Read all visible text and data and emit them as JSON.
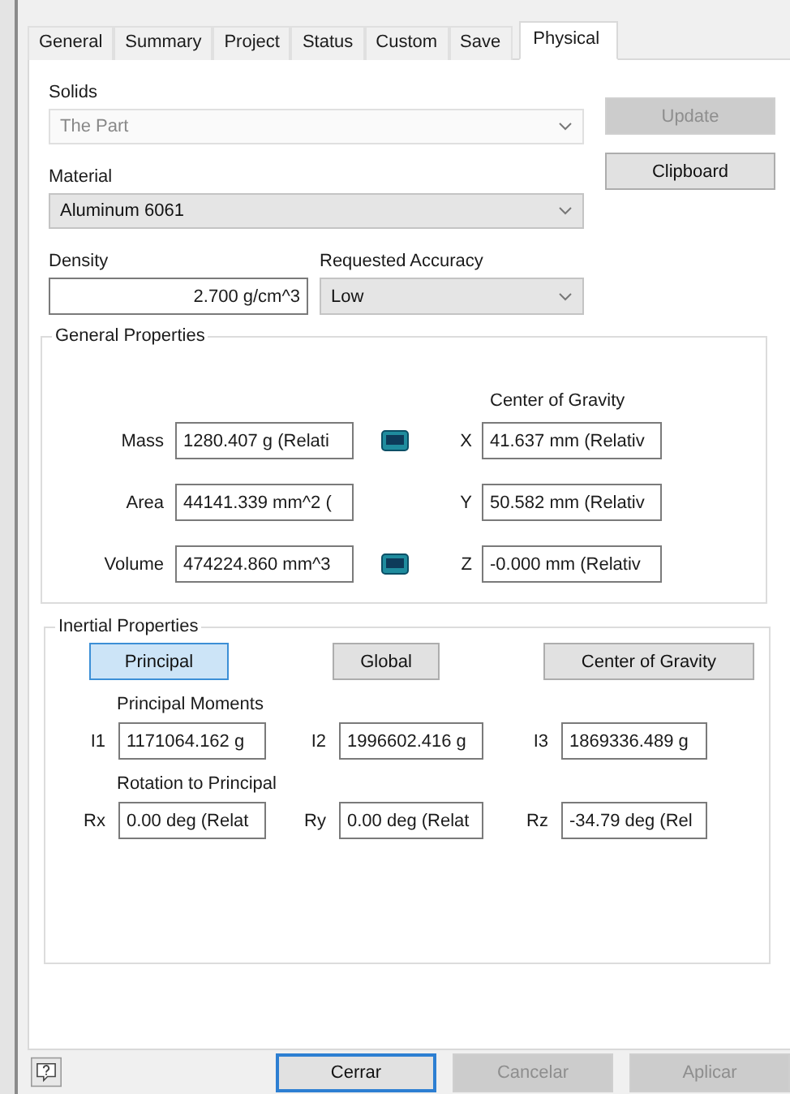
{
  "tabs": [
    {
      "label": "General",
      "selected": false
    },
    {
      "label": "Summary",
      "selected": false
    },
    {
      "label": "Project",
      "selected": false
    },
    {
      "label": "Status",
      "selected": false
    },
    {
      "label": "Custom",
      "selected": false
    },
    {
      "label": "Save",
      "selected": false
    },
    {
      "label": "Physical",
      "selected": true
    }
  ],
  "solids": {
    "label": "Solids",
    "value": "The Part",
    "disabled": true
  },
  "update_button": {
    "label": "Update",
    "disabled": true
  },
  "material": {
    "label": "Material",
    "value": "Aluminum 6061"
  },
  "clipboard_button": {
    "label": "Clipboard",
    "disabled": false
  },
  "density": {
    "label": "Density",
    "value": "2.700 g/cm^3"
  },
  "requested_accuracy": {
    "label": "Requested Accuracy",
    "value": "Low"
  },
  "general_properties": {
    "title": "General Properties",
    "center_of_gravity_label": "Center of Gravity",
    "rows": [
      {
        "label": "Mass",
        "value": "1280.407 g (Relati",
        "calculator": true,
        "axis": "X",
        "axis_value": "41.637 mm (Relativ"
      },
      {
        "label": "Area",
        "value": "44141.339 mm^2 (",
        "calculator": false,
        "axis": "Y",
        "axis_value": "50.582 mm (Relativ"
      },
      {
        "label": "Volume",
        "value": "474224.860 mm^3",
        "calculator": true,
        "axis": "Z",
        "axis_value": "-0.000 mm (Relativ"
      }
    ]
  },
  "inertial_properties": {
    "title": "Inertial Properties",
    "modes": [
      {
        "label": "Principal",
        "selected": true
      },
      {
        "label": "Global",
        "selected": false
      },
      {
        "label": "Center of Gravity",
        "selected": false
      }
    ],
    "principal_moments_label": "Principal Moments",
    "moments": [
      {
        "label": "I1",
        "value": "1171064.162 g"
      },
      {
        "label": "I2",
        "value": "1996602.416 g"
      },
      {
        "label": "I3",
        "value": "1869336.489 g"
      }
    ],
    "rotation_label": "Rotation to Principal",
    "rotations": [
      {
        "label": "Rx",
        "value": "0.00 deg (Relat"
      },
      {
        "label": "Ry",
        "value": "0.00 deg (Relat"
      },
      {
        "label": "Rz",
        "value": "-34.79 deg (Rel"
      }
    ]
  },
  "footer_buttons": [
    {
      "label": "Cerrar",
      "disabled": false,
      "focused": true
    },
    {
      "label": "Cancelar",
      "disabled": true,
      "focused": false
    },
    {
      "label": "Aplicar",
      "disabled": true,
      "focused": false
    }
  ]
}
